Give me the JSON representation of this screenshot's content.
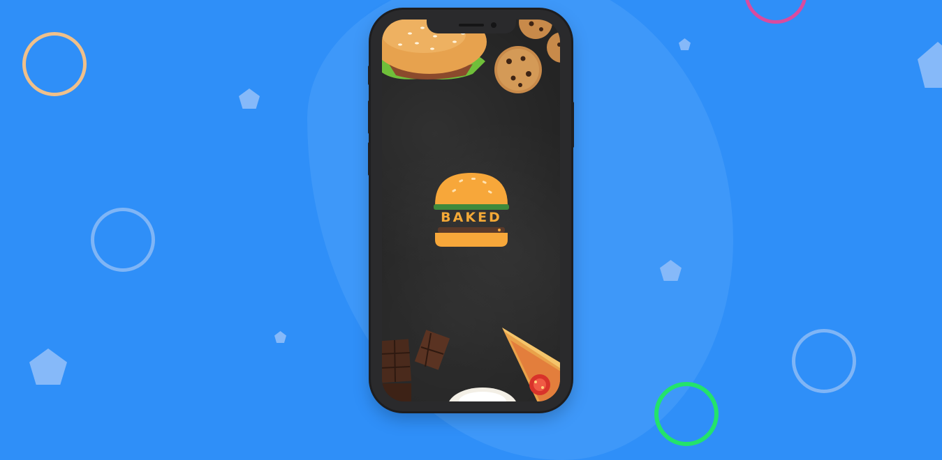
{
  "app": {
    "logo_text": "BAKED"
  },
  "colors": {
    "background": "#2f8ff8",
    "bun": "#f7a73a",
    "lettuce": "#3f8a3c",
    "patty": "#5a3a2a",
    "screen": "#242424"
  },
  "icons": {
    "logo": "burger-icon"
  }
}
